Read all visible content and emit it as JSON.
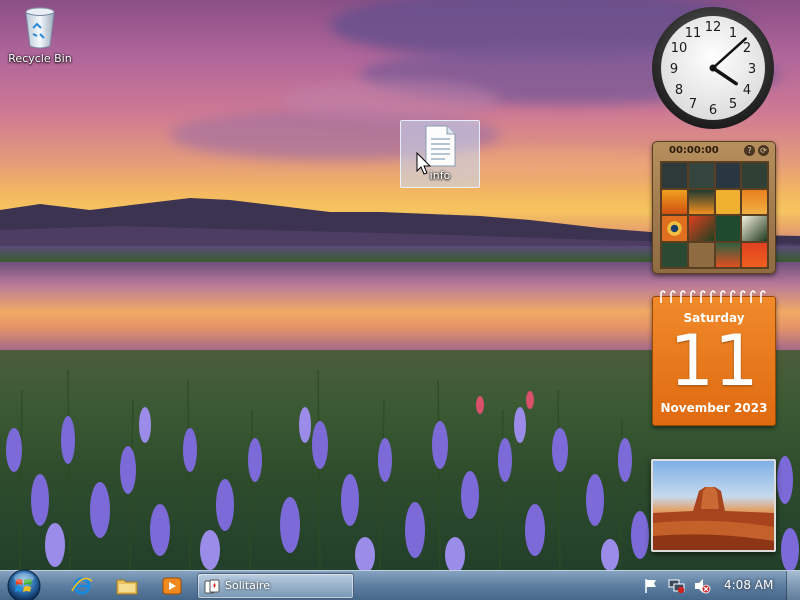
{
  "desktop": {
    "icons": [
      {
        "label": "Recycle Bin",
        "icon": "recycle-bin-icon"
      },
      {
        "label": "info",
        "icon": "text-document-icon",
        "selected": true
      }
    ]
  },
  "gadgets": {
    "clock": {
      "hour": 4,
      "minute": 8
    },
    "puzzle": {
      "timer": "00:00:00",
      "help": "?",
      "shuffle": "⟳"
    },
    "calendar": {
      "weekday": "Saturday",
      "day": "11",
      "month_year": "November 2023"
    },
    "slideshow": {
      "icon": "desert-mesa-photo"
    }
  },
  "taskbar": {
    "start_icon": "windows-start-orb-icon",
    "quick_launch": [
      {
        "name": "internet-explorer-icon"
      },
      {
        "name": "folder-explorer-icon"
      },
      {
        "name": "media-player-icon"
      }
    ],
    "windows": [
      {
        "label": "Solitaire",
        "icon": "solitaire-cards-icon"
      }
    ],
    "tray": {
      "icons": [
        "action-center-flag-icon",
        "network-icon",
        "volume-muted-icon"
      ],
      "time": "4:08 AM"
    }
  },
  "colors": {
    "accent": "#e57a1d",
    "taskbar": "#6f90b2"
  }
}
